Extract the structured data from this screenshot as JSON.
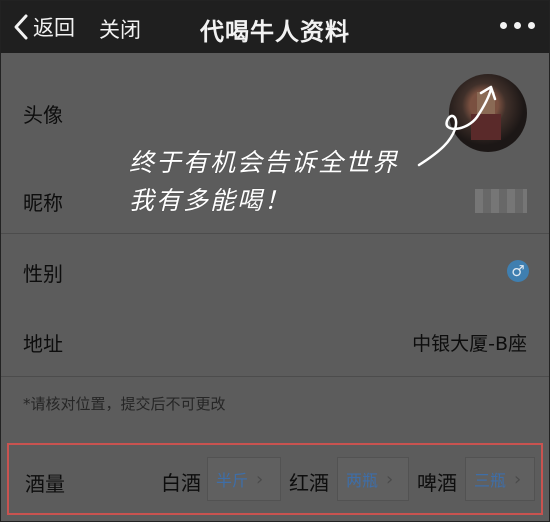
{
  "header": {
    "back_label": "返回",
    "close_label": "关闭",
    "title": "代喝牛人资料"
  },
  "rows": {
    "avatar_label": "头像",
    "nickname_label": "昵称",
    "gender_label": "性别",
    "gender_icon": "male-symbol-icon",
    "gender_symbol": "♂",
    "address_label": "地址",
    "address_value": "中银大厦-B座"
  },
  "note": "*请核对位置，提交后不可更改",
  "drink": {
    "label": "酒量",
    "items": [
      {
        "name": "白酒",
        "value": "半斤"
      },
      {
        "name": "红酒",
        "value": "两瓶"
      },
      {
        "name": "啤酒",
        "value": "三瓶"
      }
    ],
    "chevron": "›"
  },
  "annotation": {
    "line1": "终于有机会告诉全世界",
    "line2": "我有多能喝！"
  },
  "colors": {
    "header_bg": "#1f1f1f",
    "page_bg": "#5c5c5c",
    "highlight_border": "#c95350",
    "value_blue": "#3e6ea8",
    "gender_icon_bg": "#3f7fb0"
  }
}
